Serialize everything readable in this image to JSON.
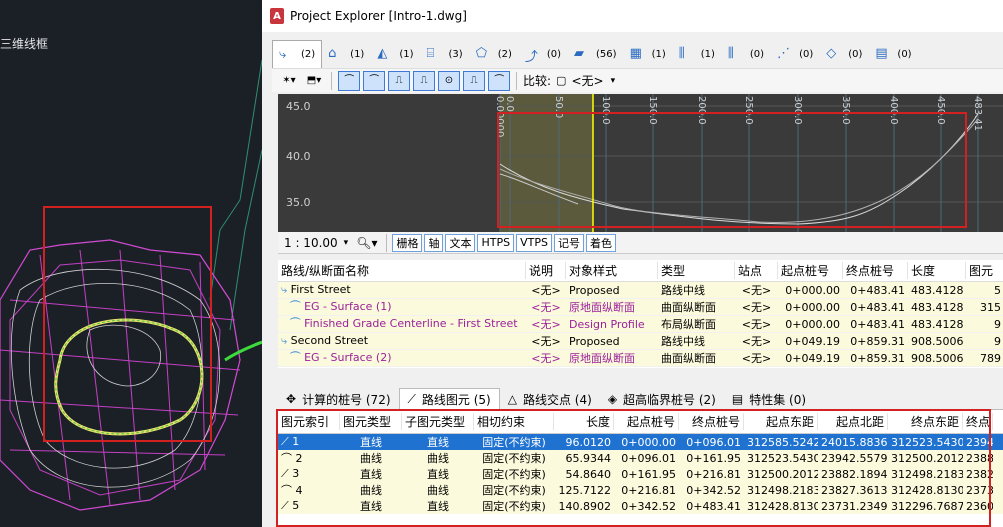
{
  "cad": {
    "viewport_label": "三维线框"
  },
  "window": {
    "title": "Project Explorer [Intro-1.dwg]",
    "app_icon": "A"
  },
  "tabs": [
    {
      "icon": "alignment-icon",
      "count": "(2)",
      "selected": true
    },
    {
      "icon": "building-icon",
      "count": "(1)"
    },
    {
      "icon": "corridor-icon",
      "count": "(1)"
    },
    {
      "icon": "assembly-icon",
      "count": "(3)"
    },
    {
      "icon": "surface-icon",
      "count": "(2)"
    },
    {
      "icon": "profile-icon",
      "count": "(0)"
    },
    {
      "icon": "pipe-icon",
      "count": "(56)"
    },
    {
      "icon": "parcel-icon",
      "count": "(1)"
    },
    {
      "icon": "section-icon",
      "count": "(1)"
    },
    {
      "icon": "section-view-icon",
      "count": "(0)"
    },
    {
      "icon": "feature-line-icon",
      "count": "(0)"
    },
    {
      "icon": "point-icon",
      "count": "(0)"
    },
    {
      "icon": "sheet-icon",
      "count": "(0)"
    }
  ],
  "toolbar": {
    "compare_label": "比较:",
    "compare_value": "<无>"
  },
  "profile_plot": {
    "y_ticks": [
      "45.0",
      "40.0",
      "35.0"
    ],
    "x_ticks": [
      "0.00000",
      "0.0",
      "50.0",
      "100.0",
      "150.0",
      "200.0",
      "250.0",
      "300.0",
      "350.0",
      "400.0",
      "450.0",
      "483.41"
    ]
  },
  "plot_bar": {
    "scale": "1 : 10.00",
    "buttons": [
      "栅格",
      "轴",
      "文本",
      "HTPS",
      "VTPS",
      "记号",
      "着色"
    ]
  },
  "alignments": {
    "headers": [
      "路线/纵断面名称",
      "说明",
      "对象样式",
      "类型",
      "站点",
      "起点桩号",
      "终点桩号",
      "长度",
      "图元"
    ],
    "rows": [
      [
        "First Street",
        "<无>",
        "Proposed",
        "路线中线",
        "<无>",
        "0+000.00",
        "0+483.41",
        "483.4128",
        "5"
      ],
      [
        "EG - Surface (1)",
        "<无>",
        "原地面纵断面",
        "曲面纵断面",
        "<无>",
        "0+000.00",
        "0+483.41",
        "483.4128",
        "315"
      ],
      [
        "Finished Grade Centerline - First Street",
        "<无>",
        "Design Profile",
        "布局纵断面",
        "<无>",
        "0+000.00",
        "0+483.41",
        "483.4128",
        "9"
      ],
      [
        "Second Street",
        "<无>",
        "Proposed",
        "路线中线",
        "<无>",
        "0+049.19",
        "0+859.31",
        "908.5006",
        "9"
      ],
      [
        "EG - Surface (2)",
        "<无>",
        "原地面纵断面",
        "曲面纵断面",
        "<无>",
        "0+049.19",
        "0+859.31",
        "908.5006",
        "789"
      ]
    ]
  },
  "bottom_tabs": [
    {
      "icon": "stations-icon",
      "label": "计算的桩号 (72)"
    },
    {
      "icon": "segment-icon",
      "label": "路线图元 (5)",
      "selected": true
    },
    {
      "icon": "pi-icon",
      "label": "路线交点 (4)"
    },
    {
      "icon": "superelevation-icon",
      "label": "超高临界桩号 (2)"
    },
    {
      "icon": "featureset-icon",
      "label": "特性集 (0)"
    }
  ],
  "segments": {
    "headers": [
      "图元索引",
      "图元类型",
      "子图元类型",
      "相切约束",
      "长度",
      "起点桩号",
      "终点桩号",
      "起点东距",
      "起点北距",
      "终点东距",
      "终点"
    ],
    "rows": [
      [
        "1",
        "直线",
        "直线",
        "固定(不约束)",
        "96.0120",
        "0+000.00",
        "0+096.01",
        "312585.5242",
        "24015.8836",
        "312523.5430",
        "2394"
      ],
      [
        "2",
        "曲线",
        "曲线",
        "固定(不约束)",
        "65.9344",
        "0+096.01",
        "0+161.95",
        "312523.5430",
        "23942.5579",
        "312500.2012",
        "2388"
      ],
      [
        "3",
        "直线",
        "直线",
        "固定(不约束)",
        "54.8640",
        "0+161.95",
        "0+216.81",
        "312500.2012",
        "23882.1894",
        "312498.2183",
        "2382"
      ],
      [
        "4",
        "曲线",
        "曲线",
        "固定(不约束)",
        "125.7122",
        "0+216.81",
        "0+342.52",
        "312498.2183",
        "23827.3613",
        "312428.8130",
        "2373"
      ],
      [
        "5",
        "直线",
        "直线",
        "固定(不约束)",
        "140.8902",
        "0+342.52",
        "0+483.41",
        "312428.8130",
        "23731.2349",
        "312296.7687",
        "2360"
      ]
    ]
  }
}
